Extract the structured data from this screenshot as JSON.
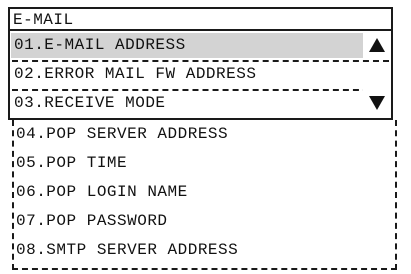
{
  "screen": {
    "title": "E-MAIL"
  },
  "menu": {
    "items": [
      {
        "label": "01.E-MAIL ADDRESS"
      },
      {
        "label": "02.ERROR MAIL FW ADDRESS"
      },
      {
        "label": "03.RECEIVE MODE"
      },
      {
        "label": "04.POP SERVER ADDRESS"
      },
      {
        "label": "05.POP TIME"
      },
      {
        "label": "06.POP LOGIN NAME"
      },
      {
        "label": "07.POP PASSWORD"
      },
      {
        "label": "08.SMTP SERVER ADDRESS"
      }
    ],
    "selected_index": 0
  },
  "icons": {
    "scroll_up": "triangle-up-icon",
    "scroll_down": "triangle-down-icon"
  },
  "colors": {
    "highlight": "#d3d3d3",
    "border": "#1a1a1a"
  }
}
